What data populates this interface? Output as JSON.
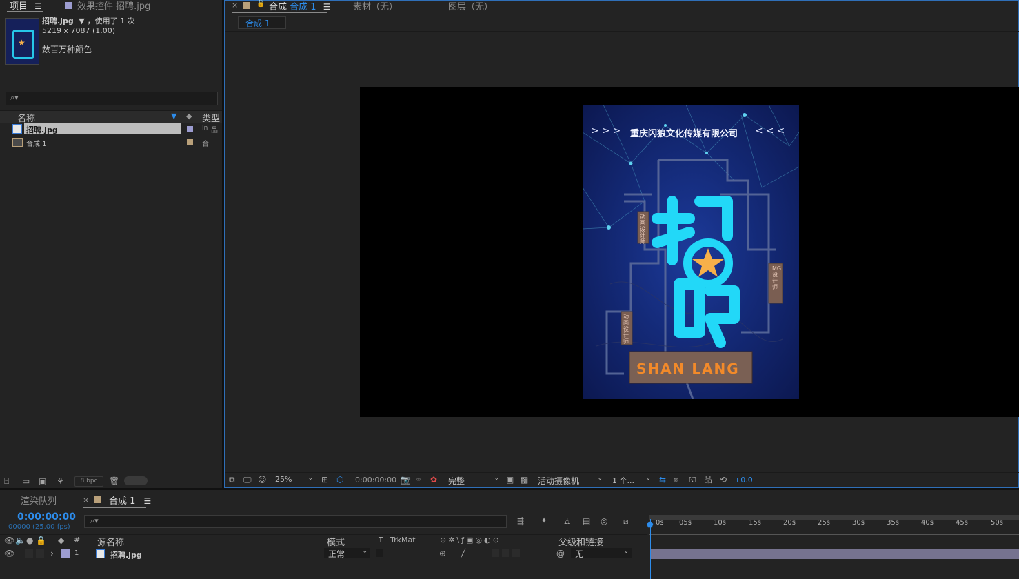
{
  "project_panel": {
    "tabs": {
      "project": "项目",
      "effects": "效果控件 招聘.jpg"
    },
    "selected_item": {
      "name": "招聘.jpg",
      "usage": "，使用了 1 次",
      "dims": "5219 x 7087 (1.00)",
      "colors": "数百万种颜色"
    },
    "search_placeholder": "",
    "columns": {
      "name": "名称",
      "type": "类型"
    },
    "items": [
      {
        "name": "招聘.jpg",
        "type_abbr": "In",
        "color": "#9c9cd0"
      },
      {
        "name": "合成 1",
        "type_abbr": "合",
        "color": "#b9a07a"
      }
    ],
    "bpc": "8 bpc"
  },
  "viewer": {
    "tabs": {
      "comp_prefix": "合成",
      "comp_name": "合成 1",
      "footage": "素材（无）",
      "layer": "图层（无）"
    },
    "breadcrumb": "合成 1",
    "poster": {
      "company": "重庆闪狼文化传媒有限公司",
      "big_text": "招聘",
      "sign_left_top": "动画设计师",
      "sign_left_bottom": "动画设计师",
      "sign_right": "MG设计师",
      "bottom_text": "SHAN LANG"
    },
    "toolbar": {
      "zoom": "25%",
      "timecode": "0:00:00:00",
      "quality": "完整",
      "camera": "活动摄像机",
      "views": "1 个...",
      "exposure": "+0.0"
    }
  },
  "timeline": {
    "tabs": {
      "render_queue": "渲染队列",
      "comp": "合成 1"
    },
    "timecode": "0:00:00:00",
    "fps": "00000 (25.00 fps)",
    "columns": {
      "num": "#",
      "source": "源名称",
      "mode": "模式",
      "t": "T",
      "trkmat": "TrkMat",
      "parent": "父级和链接"
    },
    "layer": {
      "index": "1",
      "name": "招聘.jpg",
      "mode": "正常",
      "parent": "无",
      "label_color": "#9c9cd0"
    },
    "ruler": [
      "0s",
      "05s",
      "10s",
      "15s",
      "20s",
      "25s",
      "30s",
      "35s",
      "40s",
      "45s",
      "50s"
    ]
  }
}
